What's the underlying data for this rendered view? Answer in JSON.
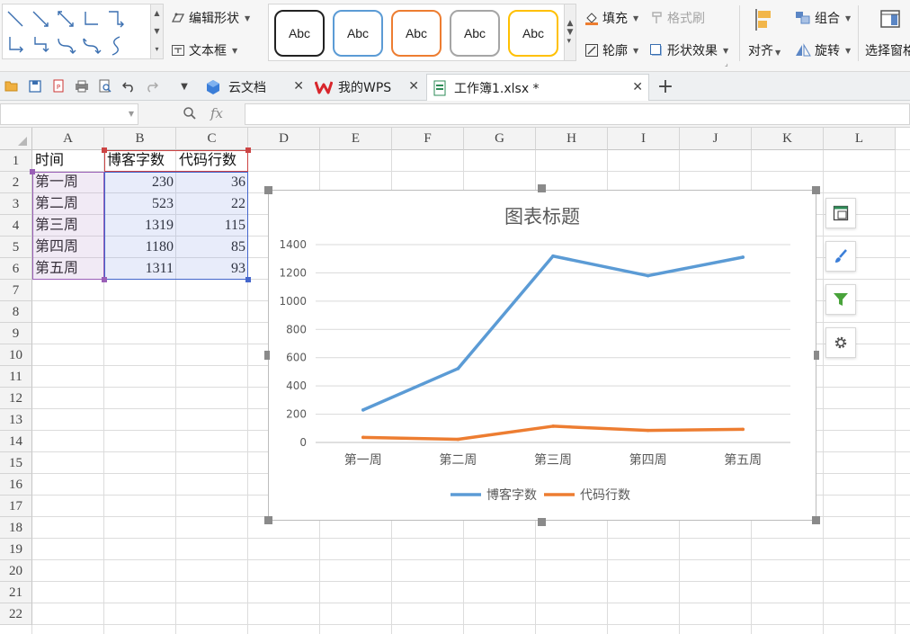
{
  "ribbon": {
    "edit_shape": "编辑形状",
    "text_box": "文本框",
    "style_samples": [
      "Abc",
      "Abc",
      "Abc",
      "Abc",
      "Abc"
    ],
    "style_colors": [
      "#222222",
      "#5b9bd5",
      "#ed7d31",
      "#a5a5a5",
      "#ffc000"
    ],
    "fill": "填充",
    "format_painter": "格式刷",
    "outline": "轮廓",
    "shape_effects": "形状效果",
    "align": "对齐",
    "group": "组合",
    "rotate": "旋转",
    "selection_pane": "选择窗格"
  },
  "tabs": {
    "cloud_docs": "云文档",
    "my_wps": "我的WPS",
    "workbook": "工作簿1.xlsx *"
  },
  "formula_bar": {
    "name_box": "",
    "fx_label": "fx",
    "content": ""
  },
  "sheet": {
    "columns": [
      "A",
      "B",
      "C",
      "D",
      "E",
      "F",
      "G",
      "H",
      "I",
      "J",
      "K",
      "L"
    ],
    "rows": [
      "1",
      "2",
      "3",
      "4",
      "5",
      "6",
      "7",
      "8",
      "9",
      "10",
      "11",
      "12",
      "13",
      "14",
      "15",
      "16",
      "17",
      "18",
      "19",
      "20",
      "21",
      "22"
    ],
    "headers": [
      "时间",
      "博客字数",
      "代码行数"
    ],
    "data": [
      [
        "第一周",
        "230",
        "36"
      ],
      [
        "第二周",
        "523",
        "22"
      ],
      [
        "第三周",
        "1319",
        "115"
      ],
      [
        "第四周",
        "1180",
        "85"
      ],
      [
        "第五周",
        "1311",
        "93"
      ]
    ]
  },
  "chart_data": {
    "type": "line",
    "title": "图表标题",
    "categories": [
      "第一周",
      "第二周",
      "第三周",
      "第四周",
      "第五周"
    ],
    "series": [
      {
        "name": "博客字数",
        "values": [
          230,
          523,
          1319,
          1180,
          1311
        ],
        "color": "#5b9bd5"
      },
      {
        "name": "代码行数",
        "values": [
          36,
          22,
          115,
          85,
          93
        ],
        "color": "#ed7d31"
      }
    ],
    "yticks": [
      "0",
      "200",
      "400",
      "600",
      "800",
      "1000",
      "1200",
      "1400"
    ],
    "ylim": [
      0,
      1400
    ],
    "grid": true,
    "legend_position": "bottom"
  }
}
